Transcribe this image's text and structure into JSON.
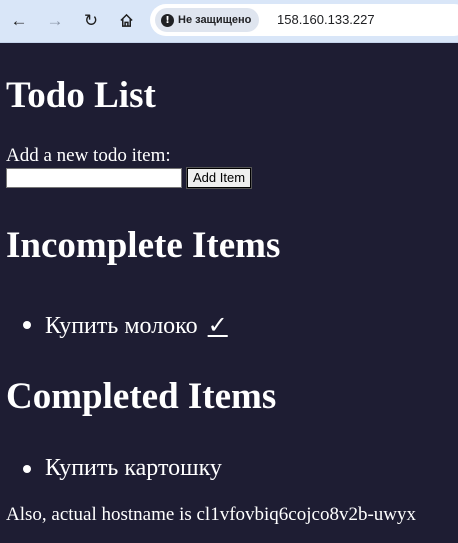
{
  "browser": {
    "back_icon": "arrow-left-icon",
    "forward_icon": "arrow-right-icon",
    "reload_icon": "reload-icon",
    "home_icon": "home-icon",
    "security_label": "Не защищено",
    "url": "158.160.133.227"
  },
  "page": {
    "title": "Todo List",
    "add_label": "Add a new todo item:",
    "input_value": "",
    "add_button": "Add Item",
    "incomplete_heading": "Incomplete Items",
    "incomplete_items": [
      {
        "text": "Купить молоко",
        "complete_link": "✓"
      }
    ],
    "completed_heading": "Completed Items",
    "completed_items": [
      {
        "text": "Купить картошку"
      }
    ],
    "hostname_text": "Also, actual hostname is cl1vfovbiq6cojco8v2b-uwyx"
  }
}
